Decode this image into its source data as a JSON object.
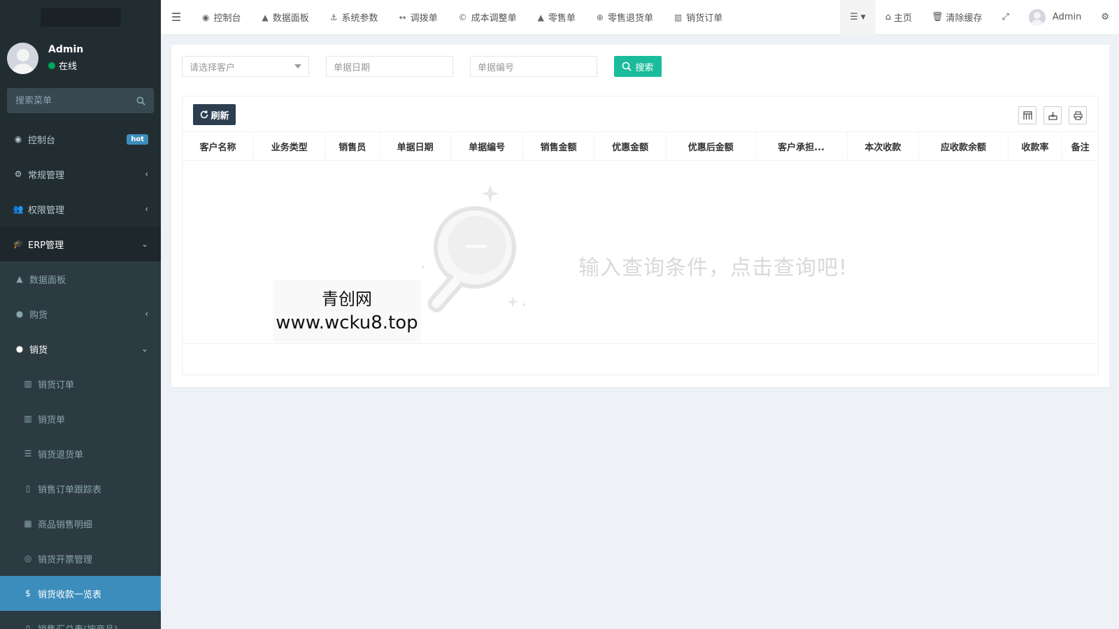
{
  "sidebar": {
    "user": {
      "name": "Admin",
      "status": "在线"
    },
    "search_placeholder": "搜索菜单",
    "menu": {
      "dashboard": {
        "label": "控制台",
        "badge": "hot"
      },
      "general": {
        "label": "常规管理"
      },
      "permission": {
        "label": "权限管理"
      },
      "erp": {
        "label": "ERP管理"
      },
      "data_panel": {
        "label": "数据面板"
      },
      "purchase": {
        "label": "购货"
      },
      "sales": {
        "label": "销货"
      },
      "sales_items": [
        "销货订单",
        "销货单",
        "销货退货单",
        "销售订单跟踪表",
        "商品销售明细",
        "销货开票管理",
        "销货收款一览表",
        "销售汇总表(按商品)"
      ]
    }
  },
  "topbar": {
    "tabs": [
      "控制台",
      "数据面板",
      "系统参数",
      "调拨单",
      "成本调整单",
      "零售单",
      "零售退货单",
      "销货订单"
    ],
    "home": "主页",
    "clear_cache": "清除缓存",
    "user": "Admin"
  },
  "filters": {
    "customer_placeholder": "请选择客户",
    "date_placeholder": "单据日期",
    "number_placeholder": "单据编号",
    "search_label": "搜索"
  },
  "toolbar": {
    "refresh_label": "刷新"
  },
  "table": {
    "columns": [
      "客户名称",
      "业务类型",
      "销售员",
      "单据日期",
      "单据编号",
      "销售金额",
      "优惠金额",
      "优惠后金额",
      "客户承担...",
      "本次收款",
      "应收款余额",
      "收款率",
      "备注"
    ],
    "empty_message": "输入查询条件，点击查询吧!"
  },
  "watermark": {
    "line1": "青创网",
    "line2": "www.wcku8.top"
  },
  "colors": {
    "sidebar": "#222d32",
    "active": "#3c8dbc",
    "search_btn": "#1abc9c",
    "refresh_btn": "#2c3e50"
  }
}
